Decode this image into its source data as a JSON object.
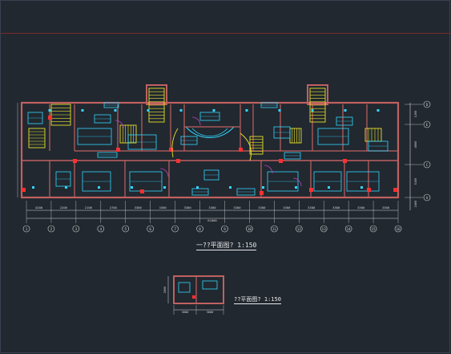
{
  "drawing": {
    "ground_floor": {
      "title": "一??平面图?  1:150",
      "row_labels": [
        "D",
        "E",
        "C",
        "A"
      ],
      "col_labels": [
        "1",
        "2",
        "3",
        "4",
        "5",
        "6",
        "7",
        "8",
        "9",
        "10",
        "11",
        "12",
        "13",
        "14",
        "15",
        "16"
      ],
      "dim_labels": [
        "4200",
        "2200",
        "2100",
        "2700",
        "3300",
        "3300",
        "3300",
        "3300",
        "3300",
        "3300",
        "3300",
        "3300",
        "3300",
        "3300",
        "3300",
        "2700"
      ],
      "overall_dim": "61000",
      "right_dims": [
        "1200",
        "4800",
        "5100",
        "2400"
      ]
    },
    "detail": {
      "title": "??平面图?  1:150",
      "dims": [
        "3600",
        "3000"
      ],
      "side_dim": "2800"
    }
  },
  "colors": {
    "background": "#212830",
    "wall": "#c06060",
    "furniture": "#33d6ff",
    "stair": "#e8e028",
    "dimension": "#d8d8d8",
    "grid_line": "#7a2a2a",
    "door": "#c040c0"
  }
}
